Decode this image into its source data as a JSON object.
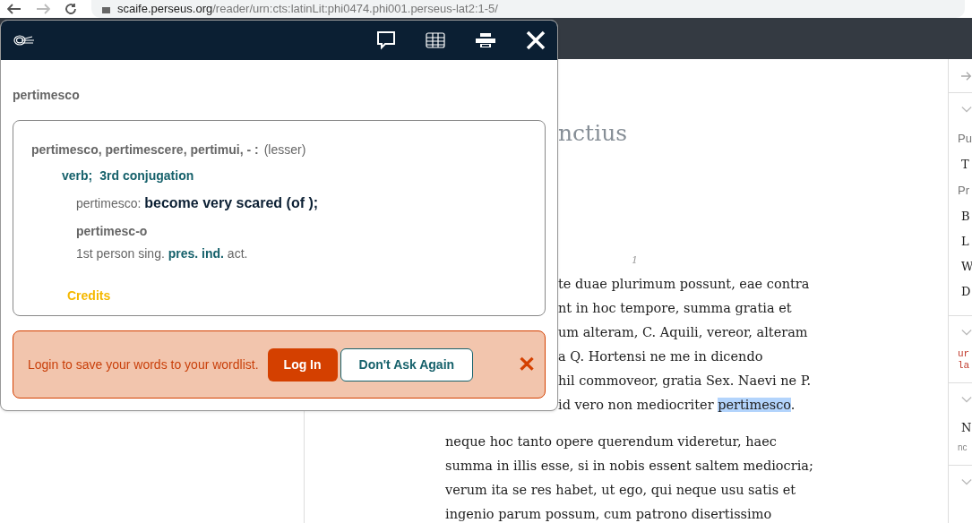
{
  "browser": {
    "url_host": "scaife.perseus.org",
    "url_path": "/reader/urn:cts:latinLit:phi0474.phi001.perseus-lat2:1-5/"
  },
  "reader": {
    "title": "nctius",
    "verse_number": "1",
    "paragraphs": [
      {
        "lines": [
          {
            "covered": true,
            "segments": [
              {
                "text": "te duae plurimum possunt, eae contra",
                "highlighted": false
              }
            ]
          },
          {
            "covered": true,
            "segments": [
              {
                "text": "nt in hoc tempore, summa gratia et",
                "highlighted": false
              }
            ]
          },
          {
            "covered": true,
            "segments": [
              {
                "text": "um alteram, C. Aquili, vereor, alteram",
                "highlighted": false
              }
            ]
          },
          {
            "covered": true,
            "segments": [
              {
                "text": "a Q. Hortensi ne me in dicendo",
                "highlighted": false
              }
            ]
          },
          {
            "covered": true,
            "segments": [
              {
                "text": "hil commoveor, gratia Sex. Naevi ne P.",
                "highlighted": false
              }
            ]
          },
          {
            "covered": true,
            "segments": [
              {
                "text": "id vero non mediocriter ",
                "highlighted": false
              },
              {
                "text": "pertimesco",
                "highlighted": true
              },
              {
                "text": ".",
                "highlighted": false
              }
            ]
          }
        ]
      },
      {
        "lines": [
          {
            "covered": false,
            "segments": [
              {
                "text": "neque hoc tanto opere querendum videretur, haec",
                "highlighted": false
              }
            ]
          },
          {
            "covered": false,
            "segments": [
              {
                "text": "summa in illis esse, si in nobis essent saltem mediocria;",
                "highlighted": false
              }
            ]
          },
          {
            "covered": false,
            "segments": [
              {
                "text": "verum ita se res habet, ut ego, qui neque usu satis et",
                "highlighted": false
              }
            ]
          },
          {
            "covered": false,
            "segments": [
              {
                "text": "ingenio parum possum, cum patrono disertissimo",
                "highlighted": false
              }
            ]
          }
        ]
      }
    ]
  },
  "sidebar": {
    "sections": [
      {
        "items": [
          {
            "kind": "heading",
            "text": "Pu"
          },
          {
            "kind": "entry",
            "text": "T"
          },
          {
            "kind": "heading",
            "text": "Pr"
          },
          {
            "kind": "entry",
            "text": "B"
          },
          {
            "kind": "entry",
            "text": "L"
          },
          {
            "kind": "entry",
            "text": "W"
          },
          {
            "kind": "entry",
            "text": "D"
          }
        ]
      },
      {
        "items": [
          {
            "kind": "code",
            "text": "ur"
          },
          {
            "kind": "code",
            "text": "la"
          }
        ]
      },
      {
        "items": [
          {
            "kind": "entry",
            "text": "N"
          },
          {
            "kind": "note",
            "text": "nc"
          }
        ]
      }
    ]
  },
  "popup": {
    "word": "pertimesco",
    "entry": {
      "headword": "pertimesco, pertimescere, pertimui, - :",
      "frequency": "(lesser)",
      "part_of_speech": "verb;",
      "conjugation": "3rd conjugation",
      "definition_label": "pertimesco:",
      "definition": "become very scared (of );",
      "form": "pertimesc-o",
      "parse_prefix": "1st person sing.",
      "parse_key": "pres. ind.",
      "parse_suffix": "act.",
      "credits": "Credits"
    },
    "login_prompt": {
      "message": "Login to save your words to your wordlist.",
      "login_button": "Log In",
      "dismiss_button": "Don't Ask Again",
      "close": "✕"
    }
  }
}
